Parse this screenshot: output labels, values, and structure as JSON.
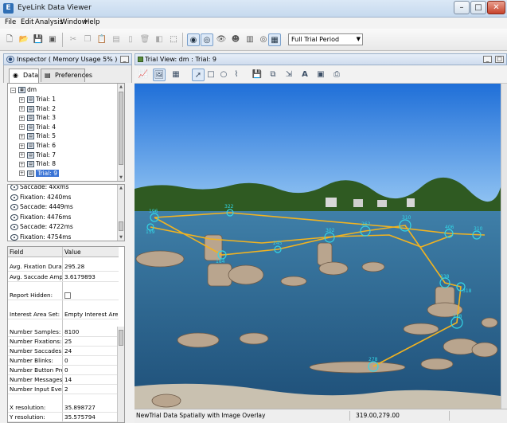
{
  "window": {
    "title": "EyeLink Data Viewer"
  },
  "menu": [
    "File",
    "Edit",
    "Analysis",
    "Window",
    "Help"
  ],
  "toolbar": {
    "period_select": "Full Trial Period",
    "buttons": [
      "scissors-icon",
      "copy-icon",
      "paste-icon",
      "clipboard-icon",
      "document-icon",
      "trash-icon",
      "cut-icon",
      "select-icon",
      "fixation-view-icon",
      "saccade-view-icon",
      "eye-icon",
      "group-icon",
      "report-icon",
      "target-icon",
      "interest-icon",
      "layout-icon"
    ]
  },
  "inspector": {
    "title": "Inspector ( Memory Usage 5% )",
    "tabs": [
      "Data",
      "Preferences"
    ],
    "tree": {
      "root": "dm",
      "trials": [
        "Trial: 1",
        "Trial: 2",
        "Trial: 3",
        "Trial: 4",
        "Trial: 5",
        "Trial: 6",
        "Trial: 7",
        "Trial: 8",
        "Trial: 9"
      ],
      "selected_index": 8
    },
    "events": [
      "Saccade: 4xxms",
      "Fixation: 4240ms",
      "Saccade: 4449ms",
      "Fixation: 4476ms",
      "Saccade: 4722ms",
      "Fixation: 4754ms"
    ],
    "properties": {
      "header": {
        "field": "Field",
        "value": "Value"
      },
      "rows": [
        {
          "field": "Avg. Fixation Dura...",
          "value": "295.28"
        },
        {
          "field": "Avg. Saccade Ampl...",
          "value": "3.6179893"
        },
        {
          "field": "Report Hidden:",
          "value": ""
        },
        {
          "field": "Interest Area Set:",
          "value": "Empty Interest Are..."
        },
        {
          "field": "Number Samples:",
          "value": "8100"
        },
        {
          "field": "Number Fixations:",
          "value": "25"
        },
        {
          "field": "Number Saccades:",
          "value": "24"
        },
        {
          "field": "Number Blinks:",
          "value": "0"
        },
        {
          "field": "Number Button Pre...",
          "value": "0"
        },
        {
          "field": "Number Messages:",
          "value": "14"
        },
        {
          "field": "Number Input Even...",
          "value": "2"
        },
        {
          "field": "X resolution:",
          "value": "35.898727"
        },
        {
          "field": "Y resolution:",
          "value": "35.575794"
        }
      ]
    }
  },
  "trial_view": {
    "title": "Trial View: dm : Trial: 9",
    "tools": [
      "chart-icon",
      "image-icon",
      "film-icon",
      "pointer-icon",
      "rectangle-icon",
      "ellipse-icon",
      "freehand-icon",
      "save-icon",
      "save-copy-icon",
      "export-icon",
      "font-icon",
      "image-export-icon",
      "print-icon"
    ],
    "fixation_labels": [
      "196",
      "159",
      "322",
      "184",
      "245",
      "302",
      "262",
      "310",
      "406",
      "310",
      "338",
      "318",
      "278",
      "278"
    ]
  },
  "status": {
    "message": "NewTrial Data Spatially with Image Overlay",
    "coords": "319.00,279.00"
  }
}
